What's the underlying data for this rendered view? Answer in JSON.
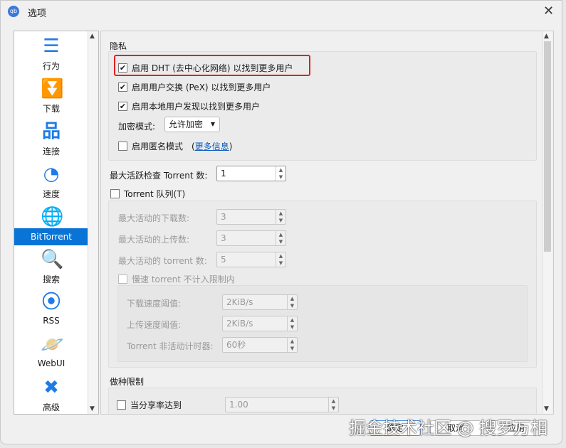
{
  "window": {
    "title": "选项",
    "logo": "qb",
    "close": "✕"
  },
  "sidebar": {
    "items": [
      {
        "label": "行为",
        "icon": "sliders-icon",
        "glyph": "☰"
      },
      {
        "label": "下载",
        "icon": "double-chevron-down-icon",
        "glyph": "⏬"
      },
      {
        "label": "连接",
        "icon": "network-icon",
        "glyph": "品"
      },
      {
        "label": "速度",
        "icon": "speedometer-icon",
        "glyph": "◔"
      },
      {
        "label": "BitTorrent",
        "icon": "globe-icon",
        "glyph": "🌐"
      },
      {
        "label": "搜索",
        "icon": "search-icon",
        "glyph": "🔍"
      },
      {
        "label": "RSS",
        "icon": "rss-icon",
        "glyph": "⦿"
      },
      {
        "label": "WebUI",
        "icon": "planet-icon",
        "glyph": "🪐"
      },
      {
        "label": "高级",
        "icon": "tools-icon",
        "glyph": "✖"
      }
    ],
    "selected": "BitTorrent"
  },
  "privacy": {
    "title": "隐私",
    "dht": "启用 DHT (去中心化网络) 以找到更多用户",
    "dht_checked": true,
    "pex": "启用用户交换 (PeX) 以找到更多用户",
    "pex_checked": true,
    "lsd": "启用本地用户发现以找到更多用户",
    "lsd_checked": true,
    "encryption_label": "加密模式:",
    "encryption_value": "允许加密",
    "anon": "启用匿名模式",
    "anon_checked": false,
    "more_info": "更多信息"
  },
  "max_checking": {
    "label": "最大活跃检查 Torrent 数:",
    "value": "1"
  },
  "queue": {
    "label": "Torrent 队列(T)",
    "checked": false,
    "max_downloads_label": "最大活动的下载数:",
    "max_downloads": "3",
    "max_uploads_label": "最大活动的上传数:",
    "max_uploads": "3",
    "max_torrents_label": "最大活动的 torrent 数:",
    "max_torrents": "5",
    "slow_label": "慢速 torrent 不计入限制内",
    "dl_threshold_label": "下载速度阈值:",
    "dl_threshold": "2KiB/s",
    "ul_threshold_label": "上传速度阈值:",
    "ul_threshold": "2KiB/s",
    "inactive_label": "Torrent 非活动计时器:",
    "inactive": "60秒"
  },
  "seeding": {
    "title": "做种限制",
    "ratio_label": "当分享率达到",
    "ratio": "1.00"
  },
  "buttons": {
    "ok": "确定",
    "cancel": "取消",
    "apply": "应用"
  },
  "watermark": "掘金技术社区 @ 搜罗万相",
  "colors": {
    "accent": "#0a74d6",
    "highlight": "#e02020"
  }
}
